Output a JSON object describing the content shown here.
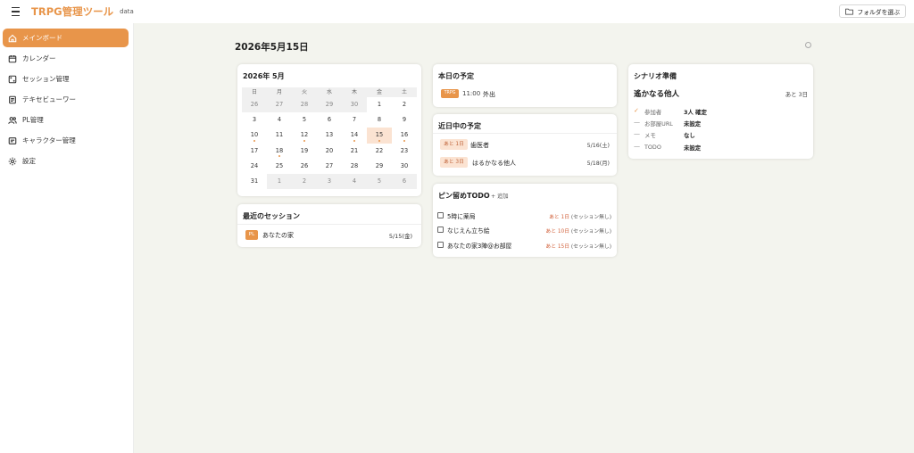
{
  "header": {
    "app_title": "TRPG管理ツール",
    "app_subtitle": "data",
    "folder_button": "フォルダを選ぶ"
  },
  "sidebar": {
    "items": [
      {
        "label": "メインボード",
        "icon": "home-icon",
        "active": true
      },
      {
        "label": "カレンダー",
        "icon": "calendar-icon",
        "active": false
      },
      {
        "label": "セッション管理",
        "icon": "dice-icon",
        "active": false
      },
      {
        "label": "テキセビューワー",
        "icon": "document-icon",
        "active": false
      },
      {
        "label": "PL管理",
        "icon": "users-icon",
        "active": false
      },
      {
        "label": "キャラクター管理",
        "icon": "id-card-icon",
        "active": false
      },
      {
        "label": "設定",
        "icon": "gear-icon",
        "active": false
      }
    ]
  },
  "main": {
    "date_title": "2026年5月15日"
  },
  "calendar": {
    "title": "2026年 5月",
    "weekdays": [
      "日",
      "月",
      "火",
      "水",
      "木",
      "金",
      "土"
    ],
    "weeks": [
      [
        {
          "d": "26",
          "m": true
        },
        {
          "d": "27",
          "m": true
        },
        {
          "d": "28",
          "m": true
        },
        {
          "d": "29",
          "m": true
        },
        {
          "d": "30",
          "m": true
        },
        {
          "d": "1"
        },
        {
          "d": "2"
        }
      ],
      [
        {
          "d": "3"
        },
        {
          "d": "4"
        },
        {
          "d": "5"
        },
        {
          "d": "6"
        },
        {
          "d": "7"
        },
        {
          "d": "8"
        },
        {
          "d": "9"
        }
      ],
      [
        {
          "d": "10",
          "dot": true
        },
        {
          "d": "11"
        },
        {
          "d": "12",
          "dot": true
        },
        {
          "d": "13"
        },
        {
          "d": "14",
          "dot": true
        },
        {
          "d": "15",
          "dot": true,
          "today": true
        },
        {
          "d": "16",
          "dot": true
        }
      ],
      [
        {
          "d": "17"
        },
        {
          "d": "18",
          "dot": true
        },
        {
          "d": "19"
        },
        {
          "d": "20"
        },
        {
          "d": "21"
        },
        {
          "d": "22"
        },
        {
          "d": "23"
        }
      ],
      [
        {
          "d": "24"
        },
        {
          "d": "25"
        },
        {
          "d": "26"
        },
        {
          "d": "27"
        },
        {
          "d": "28"
        },
        {
          "d": "29"
        },
        {
          "d": "30"
        }
      ],
      [
        {
          "d": "31"
        },
        {
          "d": "1",
          "m": true
        },
        {
          "d": "2",
          "m": true
        },
        {
          "d": "3",
          "m": true
        },
        {
          "d": "4",
          "m": true
        },
        {
          "d": "5",
          "m": true
        },
        {
          "d": "6",
          "m": true
        }
      ]
    ]
  },
  "recent_sessions": {
    "title": "最近のセッション",
    "items": [
      {
        "badge": "PL",
        "name": "あなたの家",
        "date": "5/15(金)"
      }
    ]
  },
  "today": {
    "title": "本日の予定",
    "items": [
      {
        "badge": "TRPG",
        "time": "11:00",
        "name": "外出"
      }
    ]
  },
  "upcoming": {
    "title": "近日中の予定",
    "items": [
      {
        "badge": "あと 1日",
        "name": "歯医者",
        "date": "5/16(土)"
      },
      {
        "badge": "あと 3日",
        "name": "はるかなる他人",
        "date": "5/18(月)"
      }
    ]
  },
  "todo": {
    "title": "ピン留めTODO",
    "add_label": "+ 追加",
    "items": [
      {
        "text": "5時に薬局",
        "remain": "あと 1日",
        "note": "(セッション無し)"
      },
      {
        "text": "なじえん立ち絵",
        "remain": "あと 10日",
        "note": "(セッション無し)"
      },
      {
        "text": "あなたの家3陣@お部屋",
        "remain": "あと 15日",
        "note": "(セッション無し)"
      }
    ]
  },
  "scenario": {
    "title": "シナリオ準備",
    "name": "遙かなる他人",
    "remaining": "あと 3日",
    "rows": [
      {
        "mark": "✓",
        "ok": true,
        "label": "参加者",
        "value": "3人 確定"
      },
      {
        "mark": "—",
        "ok": false,
        "label": "お部屋URL",
        "value": "未設定"
      },
      {
        "mark": "—",
        "ok": false,
        "label": "メモ",
        "value": "なし"
      },
      {
        "mark": "—",
        "ok": false,
        "label": "TODO",
        "value": "未設定"
      }
    ]
  },
  "colors": {
    "accent": "#e8954a",
    "background": "#f3f4ee",
    "today_cell": "#fbe3d2",
    "remain_text": "#d1603a"
  }
}
